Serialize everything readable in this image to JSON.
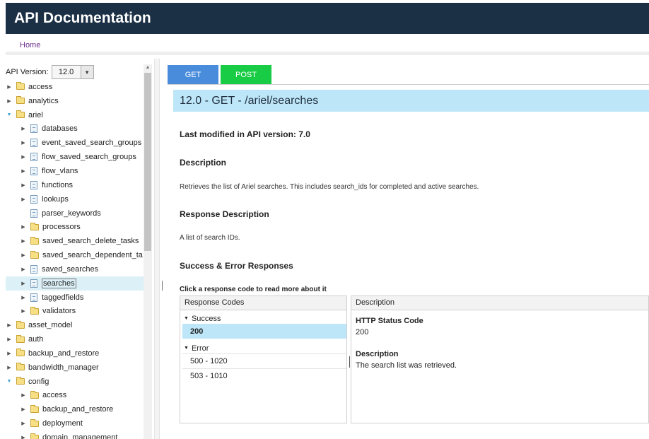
{
  "header": {
    "title": "API Documentation"
  },
  "nav": {
    "home": "Home"
  },
  "sidebar": {
    "version_label": "API Version:",
    "version_value": "12.0",
    "tree": [
      {
        "label": "access",
        "type": "folder",
        "level": 0,
        "expanded": false
      },
      {
        "label": "analytics",
        "type": "folder",
        "level": 0,
        "expanded": false
      },
      {
        "label": "ariel",
        "type": "folder",
        "level": 0,
        "expanded": true
      },
      {
        "label": "databases",
        "type": "doc",
        "level": 1,
        "expanded": false
      },
      {
        "label": "event_saved_search_groups",
        "type": "doc",
        "level": 1,
        "expanded": false
      },
      {
        "label": "flow_saved_search_groups",
        "type": "doc",
        "level": 1,
        "expanded": false
      },
      {
        "label": "flow_vlans",
        "type": "doc",
        "level": 1,
        "expanded": false
      },
      {
        "label": "functions",
        "type": "doc",
        "level": 1,
        "expanded": false
      },
      {
        "label": "lookups",
        "type": "doc",
        "level": 1,
        "expanded": false
      },
      {
        "label": "parser_keywords",
        "type": "doc",
        "level": 1,
        "leaf": true
      },
      {
        "label": "processors",
        "type": "folder",
        "level": 1,
        "expanded": false
      },
      {
        "label": "saved_search_delete_tasks",
        "type": "folder",
        "level": 1,
        "expanded": false
      },
      {
        "label": "saved_search_dependent_ta",
        "type": "folder",
        "level": 1,
        "expanded": false
      },
      {
        "label": "saved_searches",
        "type": "doc",
        "level": 1,
        "expanded": false
      },
      {
        "label": "searches",
        "type": "doc",
        "level": 1,
        "expanded": false,
        "selected": true
      },
      {
        "label": "taggedfields",
        "type": "doc",
        "level": 1,
        "expanded": false
      },
      {
        "label": "validators",
        "type": "folder",
        "level": 1,
        "expanded": false
      },
      {
        "label": "asset_model",
        "type": "folder",
        "level": 0,
        "expanded": false
      },
      {
        "label": "auth",
        "type": "folder",
        "level": 0,
        "expanded": false
      },
      {
        "label": "backup_and_restore",
        "type": "folder",
        "level": 0,
        "expanded": false
      },
      {
        "label": "bandwidth_manager",
        "type": "folder",
        "level": 0,
        "expanded": false
      },
      {
        "label": "config",
        "type": "folder",
        "level": 0,
        "expanded": true
      },
      {
        "label": "access",
        "type": "folder",
        "level": 1,
        "expanded": false
      },
      {
        "label": "backup_and_restore",
        "type": "folder",
        "level": 1,
        "expanded": false
      },
      {
        "label": "deployment",
        "type": "folder",
        "level": 1,
        "expanded": false
      },
      {
        "label": "domain_management",
        "type": "folder",
        "level": 1,
        "expanded": false
      }
    ]
  },
  "main": {
    "tabs": {
      "get": "GET",
      "post": "POST"
    },
    "title": "12.0 - GET - /ariel/searches",
    "last_modified": "Last modified in API version: 7.0",
    "description_heading": "Description",
    "description_text": "Retrieves the list of Ariel searches. This includes search_ids for completed and active searches.",
    "response_description_heading": "Response Description",
    "response_description_text": "A list of search IDs.",
    "responses_heading": "Success & Error Responses",
    "responses_hint": "Click a response code to read more about it",
    "codes_panel": {
      "header": "Response Codes",
      "success_label": "Success",
      "success_codes": [
        "200"
      ],
      "error_label": "Error",
      "error_codes": [
        "500 - 1020",
        "503 - 1010"
      ]
    },
    "desc_panel": {
      "header": "Description",
      "status_heading": "HTTP Status Code",
      "status_value": "200",
      "desc_heading": "Description",
      "desc_value": "The search list was retrieved."
    }
  },
  "colors": {
    "header_bg": "#1b2f45",
    "get_tab": "#4a8cdc",
    "post_tab": "#19cc45",
    "title_bar": "#bde6f8",
    "selected_row": "#dcf0f7"
  }
}
